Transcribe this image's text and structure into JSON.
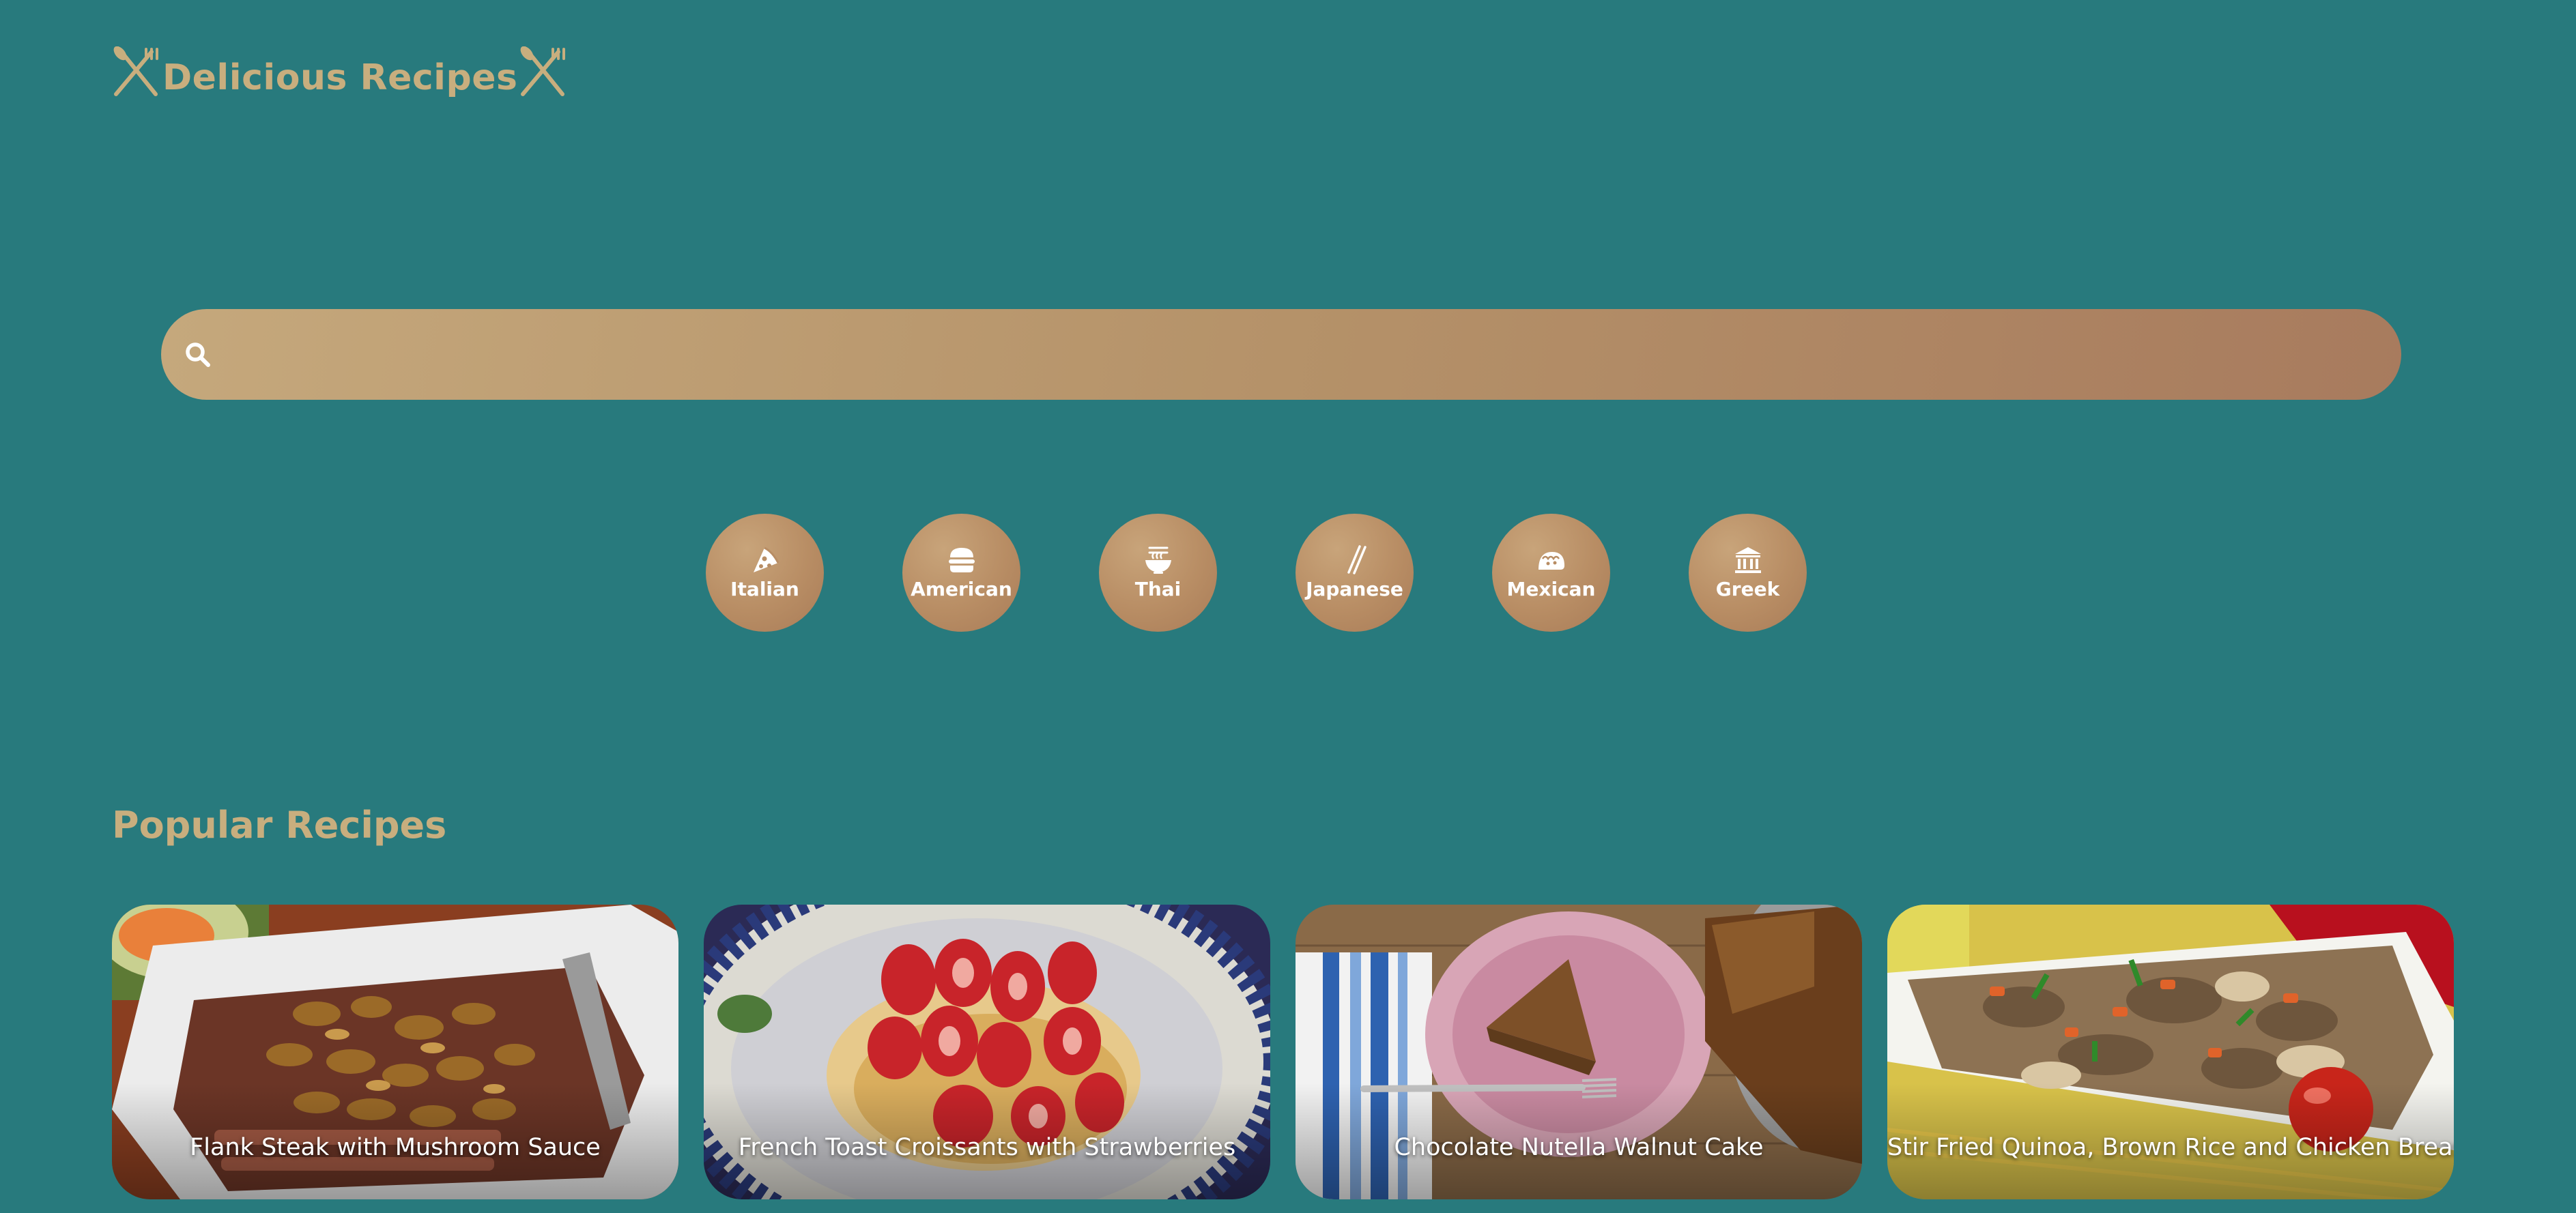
{
  "header": {
    "title": "Delicious Recipes",
    "icon_left": "utensils-icon",
    "icon_right": "utensils-icon"
  },
  "search": {
    "placeholder": "",
    "value": "",
    "icon": "search-icon"
  },
  "cuisines": [
    {
      "label": "Italian",
      "icon": "pizza-icon"
    },
    {
      "label": "American",
      "icon": "burger-icon"
    },
    {
      "label": "Thai",
      "icon": "noodle-bowl-icon"
    },
    {
      "label": "Japanese",
      "icon": "chopsticks-icon"
    },
    {
      "label": "Mexican",
      "icon": "taco-icon"
    },
    {
      "label": "Greek",
      "icon": "temple-icon"
    }
  ],
  "popular": {
    "heading": "Popular Recipes",
    "recipes": [
      {
        "title": "Flank Steak with Mushroom Sauce"
      },
      {
        "title": "French Toast Croissants with Strawberries"
      },
      {
        "title": "Chocolate Nutella Walnut Cake"
      },
      {
        "title": "Stir Fried Quinoa, Brown Rice and Chicken Breast"
      }
    ]
  },
  "colors": {
    "background": "#287a7d",
    "accent": "#c8ae7e",
    "button": "#b88d64"
  }
}
